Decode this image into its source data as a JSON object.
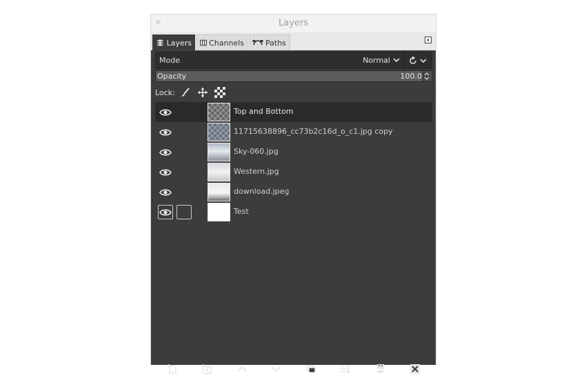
{
  "window": {
    "title": "Layers",
    "close_glyph": "×"
  },
  "tabs": [
    {
      "label": "Layers",
      "icon": "layers-icon",
      "active": true
    },
    {
      "label": "Channels",
      "icon": "channels-icon",
      "active": false
    },
    {
      "label": "Paths",
      "icon": "paths-icon",
      "active": false
    }
  ],
  "mode": {
    "label": "Mode",
    "value": "Normal"
  },
  "opacity": {
    "label": "Opacity",
    "value": "100.0"
  },
  "lock": {
    "label": "Lock:",
    "buttons": [
      "paintbrush-icon",
      "move-icon",
      "alpha-checker-icon"
    ]
  },
  "layers": [
    {
      "name": "Top and Bottom",
      "visible": true,
      "selected": true,
      "thumb": "transparent"
    },
    {
      "name": "11715638896_cc73b2c16d_o_c1.jpg copy",
      "visible": true,
      "selected": false,
      "thumb": "pattern"
    },
    {
      "name": "Sky-060.jpg",
      "visible": true,
      "selected": false,
      "thumb": "sky"
    },
    {
      "name": "Western.jpg",
      "visible": true,
      "selected": false,
      "thumb": "western"
    },
    {
      "name": "download.jpeg",
      "visible": true,
      "selected": false,
      "thumb": "download"
    },
    {
      "name": "Test",
      "visible": true,
      "selected": false,
      "thumb": "white"
    }
  ],
  "bottom_buttons": [
    "new-layer-icon",
    "new-layer-group-icon",
    "raise-layer-icon",
    "lower-layer-icon",
    "duplicate-layer-icon",
    "merge-down-icon",
    "anchor-layer-icon",
    "delete-layer-icon"
  ],
  "colors": {
    "panel_bg": "#3c3c3c",
    "selected_row": "#2a2a2a",
    "text": "#e4e4e4"
  }
}
